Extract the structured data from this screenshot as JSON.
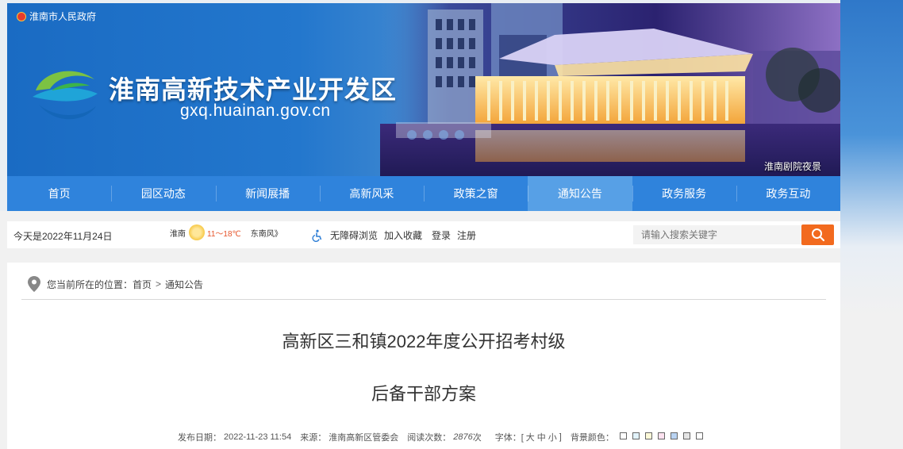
{
  "header": {
    "gov_link": "淮南市人民政府",
    "site_title": "淮南高新技术产业开发区",
    "site_domain": "gxq.huainan.gov.cn",
    "photo_caption": "淮南剧院夜景"
  },
  "nav": {
    "items": [
      {
        "label": "首页"
      },
      {
        "label": "园区动态"
      },
      {
        "label": "新闻展播"
      },
      {
        "label": "高新风采"
      },
      {
        "label": "政策之窗"
      },
      {
        "label": "通知公告"
      },
      {
        "label": "政务服务"
      },
      {
        "label": "政务互动"
      }
    ],
    "active_index": 5
  },
  "infobar": {
    "date_text": "今天是2022年11月24日",
    "weather": {
      "city": "淮南",
      "temp": "11～18℃",
      "wind": "东南风",
      "arrow": "》"
    },
    "accessibility": "无障碍浏览",
    "favorite": "加入收藏",
    "login": "登录",
    "register": "注册",
    "search_placeholder": "请输入搜索关键字"
  },
  "breadcrumb": {
    "prefix": "您当前所在的位置：",
    "home": "首页",
    "separator": ">",
    "current": "通知公告"
  },
  "article": {
    "title_line1": "高新区三和镇2022年度公开招考村级",
    "title_line2": "后备干部方案",
    "meta": {
      "date_label": "发布日期：",
      "date": "2022-11-23 11:54",
      "source_label": "来源：",
      "source": "淮南高新区管委会",
      "views_label": "阅读次数：",
      "views": "2876",
      "views_unit": "次",
      "font_label": "字体：[",
      "font_large": "大",
      "font_medium": "中",
      "font_small": "小",
      "font_close": "]",
      "bg_label": "背景颜色："
    },
    "bg_colors": [
      "#ffffff",
      "#e2f3fb",
      "#fdf9d8",
      "#fde2f0",
      "#b9d3f2",
      "#e5e5e5",
      "#ffffff"
    ]
  },
  "colors": {
    "nav_bg": "#2f83dc",
    "nav_active": "#57a0e6",
    "search_button": "#f26a1e"
  }
}
